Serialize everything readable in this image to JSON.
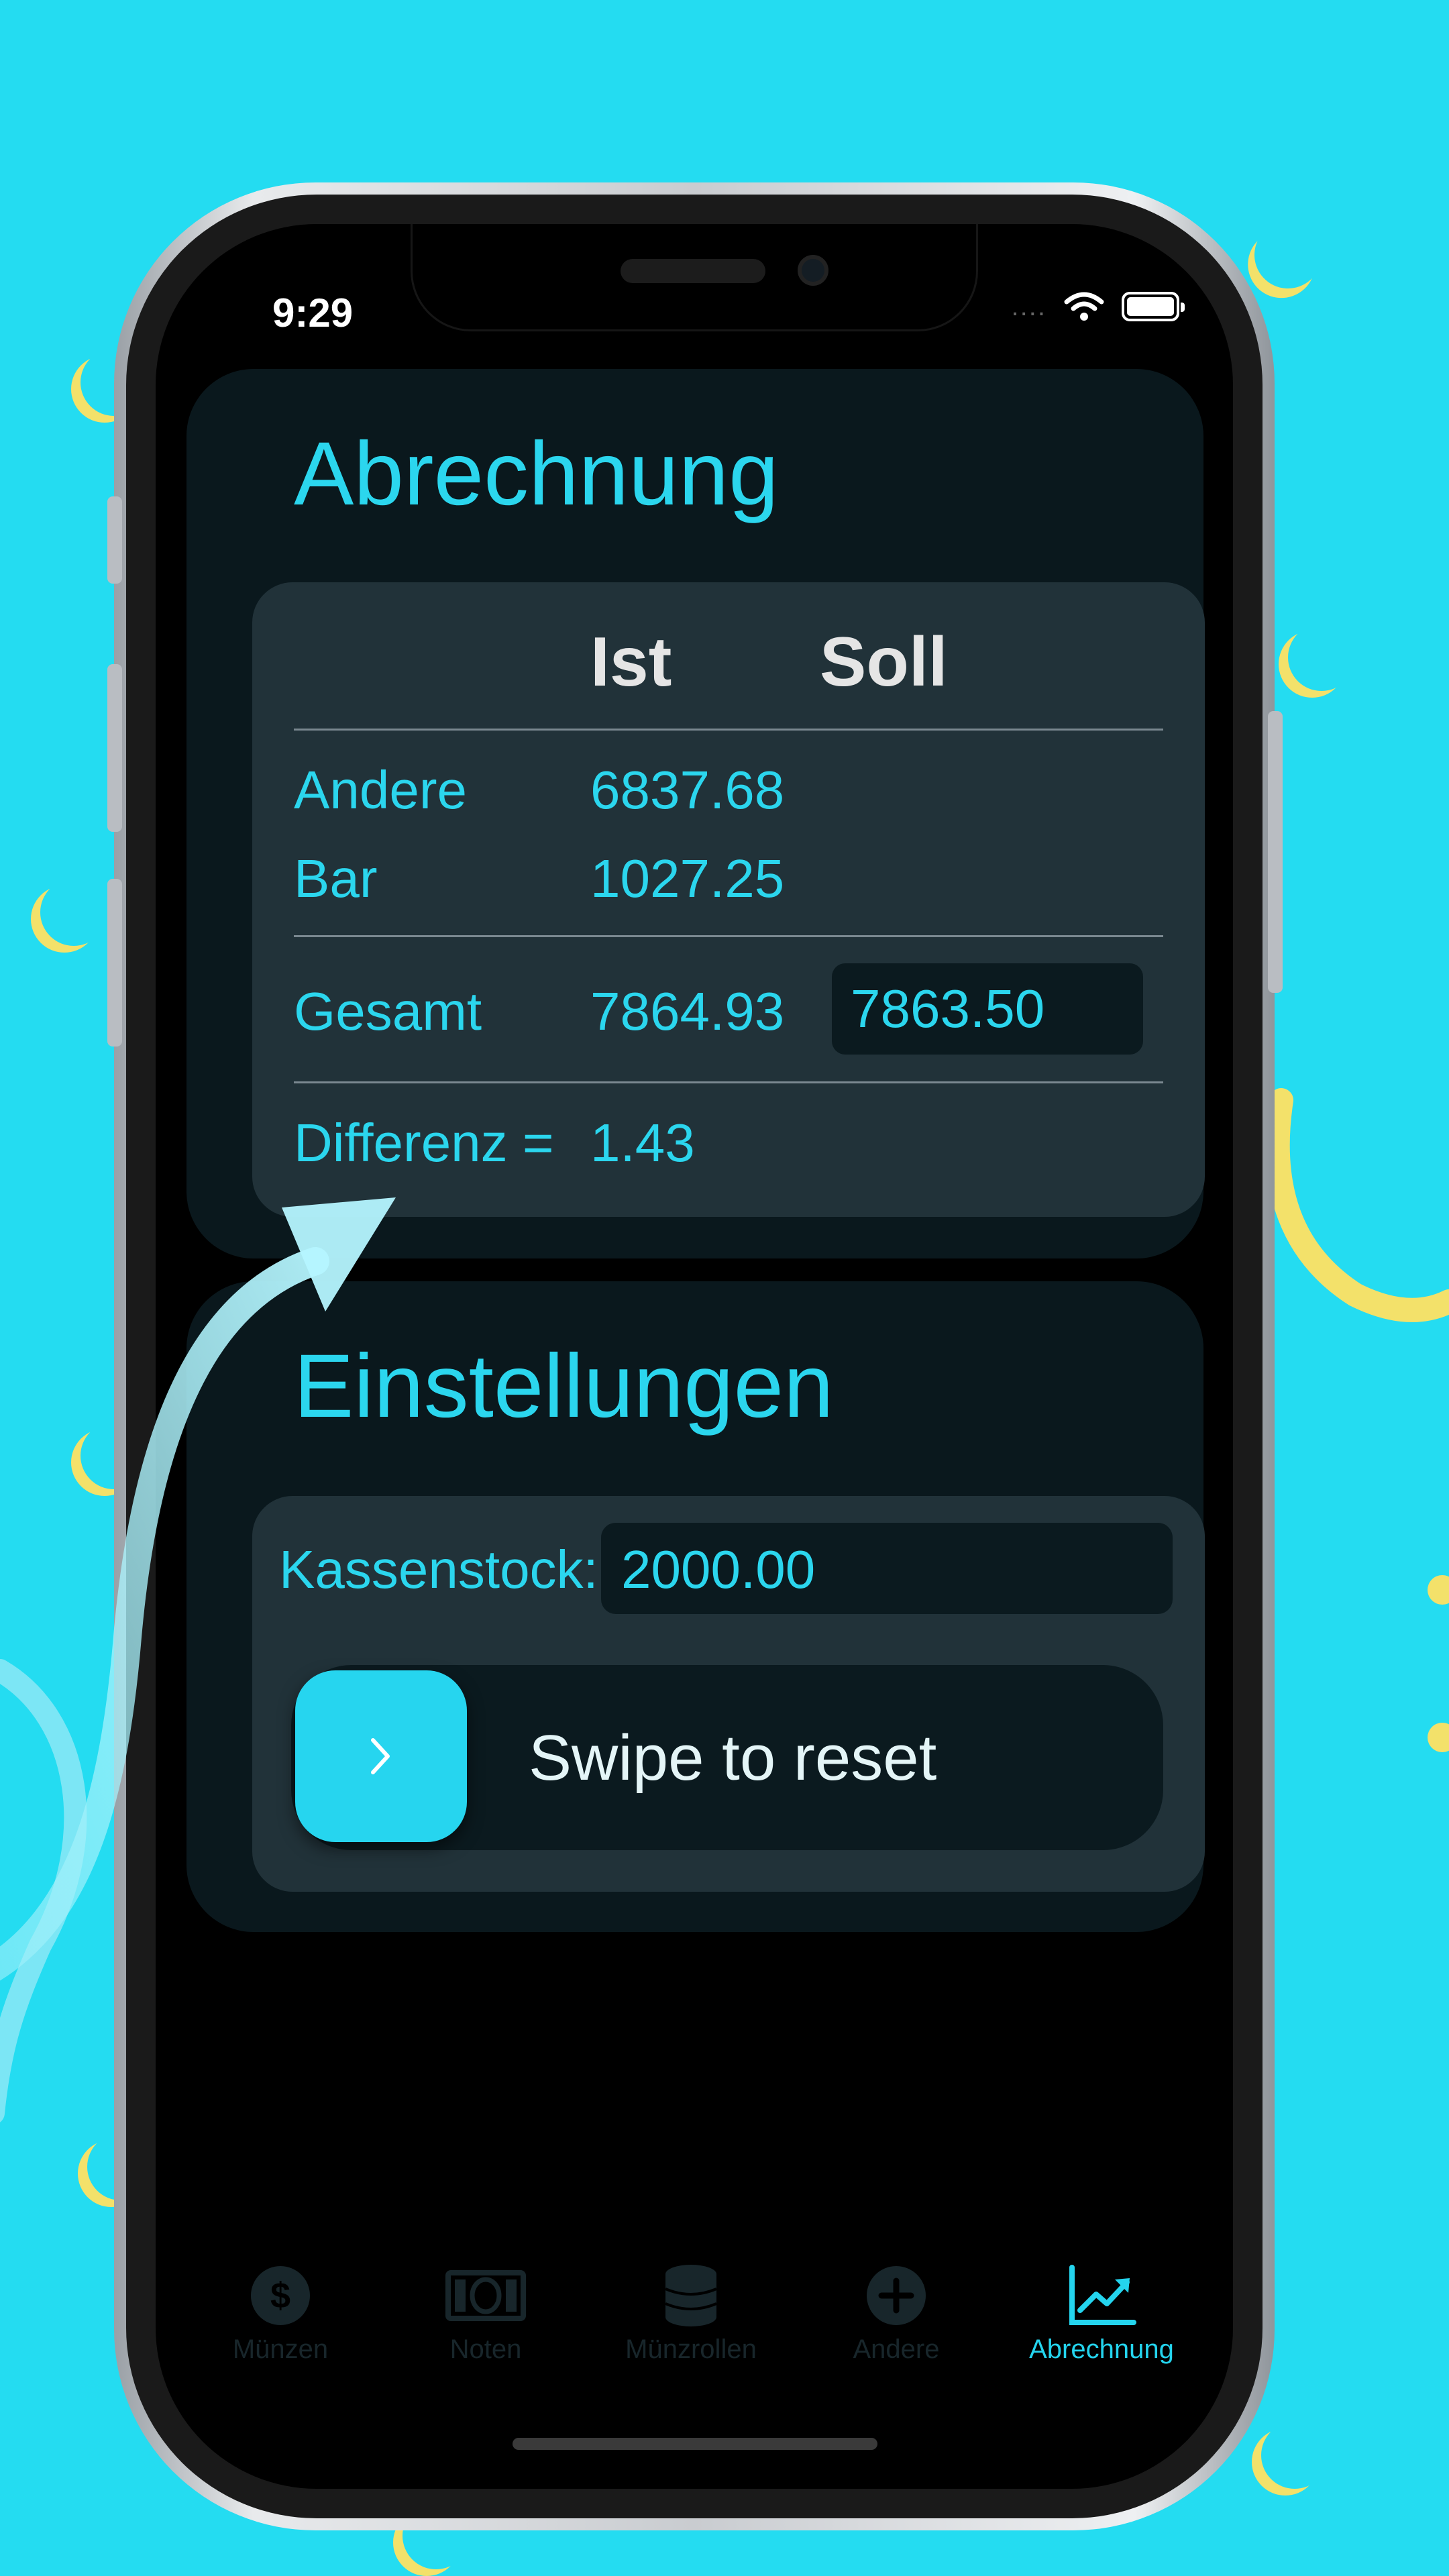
{
  "colors": {
    "background": "#24dcf1",
    "accent": "#2bd6ee",
    "card": "#0a181d",
    "panel": "#213239",
    "moon": "#f3e16a"
  },
  "status_bar": {
    "time": "9:29",
    "signal": "....",
    "icons": [
      "wifi-icon",
      "battery-icon"
    ]
  },
  "abrechnung": {
    "title": "Abrechnung",
    "headers": {
      "ist": "Ist",
      "soll": "Soll"
    },
    "rows": [
      {
        "label": "Andere",
        "ist": "6837.68"
      },
      {
        "label": "Bar",
        "ist": "1027.25"
      }
    ],
    "total": {
      "label": "Gesamt",
      "ist": "7864.93",
      "soll": "7863.50"
    },
    "difference": {
      "label": "Differenz =",
      "value": "1.43"
    }
  },
  "einstellungen": {
    "title": "Einstellungen",
    "kassenstock_label": "Kassenstock:",
    "kassenstock_value": "2000.00",
    "swipe_label": "Swipe to reset",
    "swipe_icon": "chevron-right-icon"
  },
  "tabs": [
    {
      "label": "Münzen",
      "icon": "dollar-coin-icon",
      "active": false
    },
    {
      "label": "Noten",
      "icon": "banknote-icon",
      "active": false
    },
    {
      "label": "Münzrollen",
      "icon": "coin-stack-icon",
      "active": false
    },
    {
      "label": "Andere",
      "icon": "plus-circle-icon",
      "active": false
    },
    {
      "label": "Abrechnung",
      "icon": "chart-line-icon",
      "active": true
    }
  ]
}
